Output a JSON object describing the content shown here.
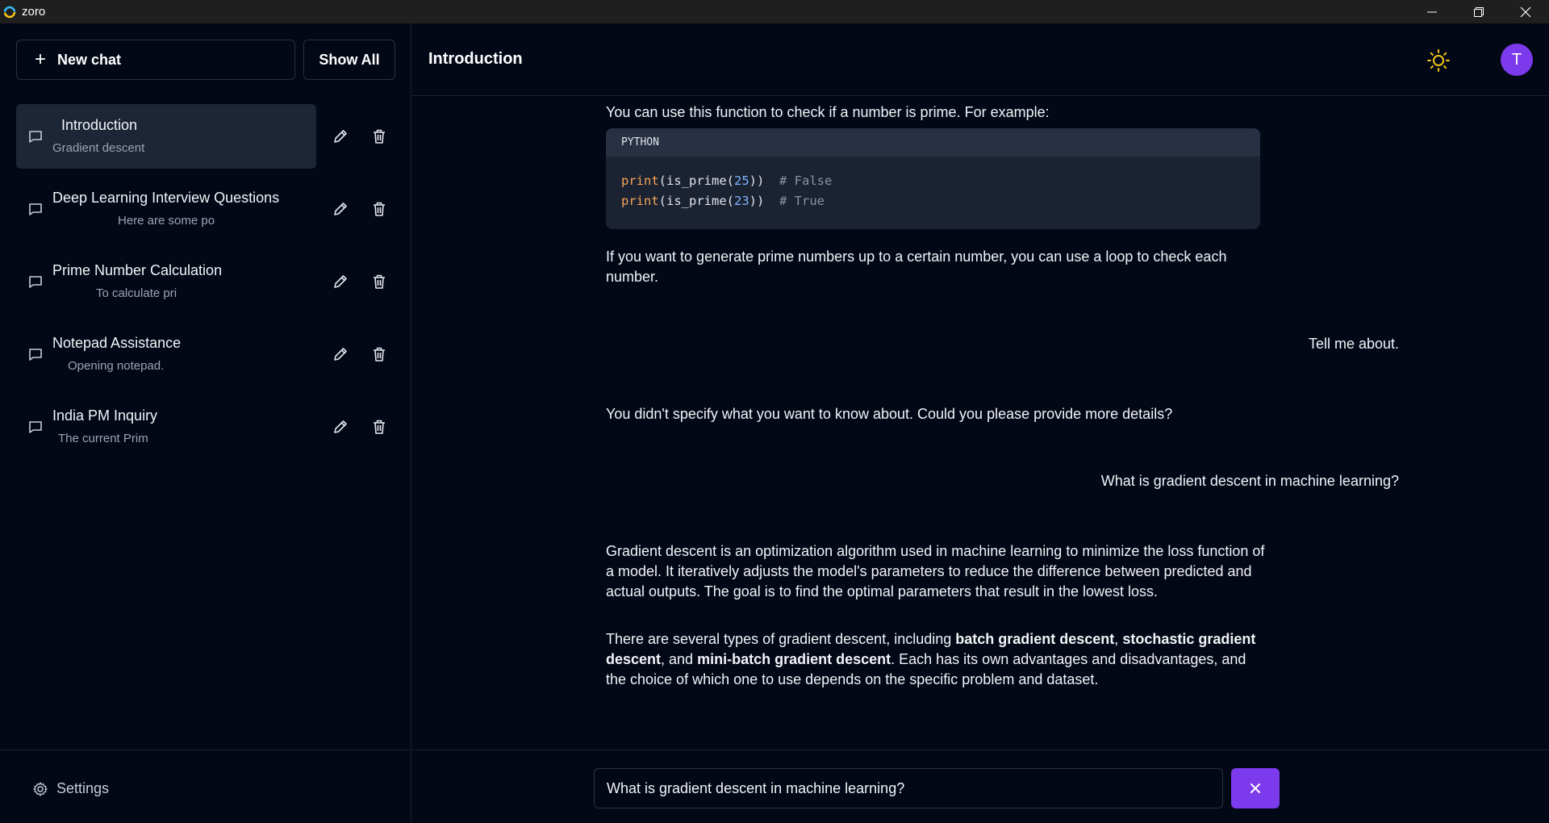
{
  "window": {
    "app_name": "zoro"
  },
  "sidebar": {
    "new_chat_label": "New chat",
    "show_all_label": "Show All",
    "chats": [
      {
        "title": "Introduction",
        "preview": "Gradient descent",
        "active": true
      },
      {
        "title": "Deep Learning Interview Questions",
        "preview": "Here are some po"
      },
      {
        "title": "Prime Number Calculation",
        "preview": "To calculate pri"
      },
      {
        "title": "Notepad Assistance",
        "preview": "Opening notepad."
      },
      {
        "title": "India PM Inquiry",
        "preview": "The current Prim"
      }
    ],
    "settings_label": "Settings"
  },
  "header": {
    "title": "Introduction",
    "avatar_initial": "T"
  },
  "conversation": {
    "m1": "You can use this function to check if a number is prime. For example:",
    "code_lang": "PYTHON",
    "code_line1": {
      "fn": "print",
      "a": "(is_prime(",
      "num": "25",
      "b": "))  ",
      "comment": "# False"
    },
    "code_line2": {
      "fn": "print",
      "a": "(is_prime(",
      "num": "23",
      "b": "))  ",
      "comment": "# True"
    },
    "m2": "If you want to generate prime numbers up to a certain number, you can use a loop to check each number.",
    "u1": "Tell me about.",
    "m3": "You didn't specify what you want to know about. Could you please provide more details?",
    "u2": "What is gradient descent in machine learning?",
    "m4": "Gradient descent is an optimization algorithm used in machine learning to minimize the loss function of a model. It iteratively adjusts the model's parameters to reduce the difference between predicted and actual outputs. The goal is to find the optimal parameters that result in the lowest loss.",
    "m5": {
      "p1": "There are several types of gradient descent, including ",
      "b1": "batch gradient descent",
      "p2": ", ",
      "b2": "stochastic gradient descent",
      "p3": ", and ",
      "b3": "mini-batch gradient descent",
      "p4": ". Each has its own advantages and disadvantages, and the choice of which one to use depends on the specific problem and dataset."
    }
  },
  "composer": {
    "input_value": "What is gradient descent in machine learning?"
  },
  "colors": {
    "accent": "#7c3aed",
    "background": "#030816",
    "sun": "#f5c518"
  }
}
